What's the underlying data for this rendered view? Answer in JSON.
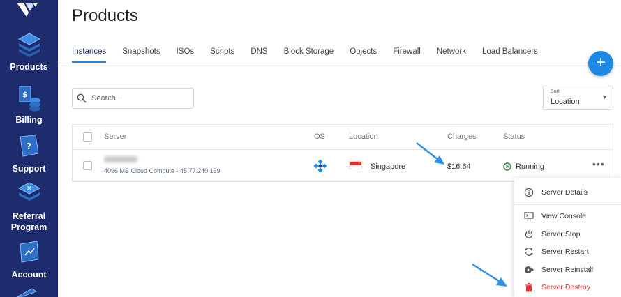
{
  "sidebar": {
    "items": [
      {
        "label": "Products"
      },
      {
        "label": "Billing"
      },
      {
        "label": "Support"
      },
      {
        "label": "Referral Program"
      },
      {
        "label": "Account"
      }
    ]
  },
  "page": {
    "title": "Products"
  },
  "tabs": [
    {
      "label": "Instances"
    },
    {
      "label": "Snapshots"
    },
    {
      "label": "ISOs"
    },
    {
      "label": "Scripts"
    },
    {
      "label": "DNS"
    },
    {
      "label": "Block Storage"
    },
    {
      "label": "Objects"
    },
    {
      "label": "Firewall"
    },
    {
      "label": "Network"
    },
    {
      "label": "Load Balancers"
    }
  ],
  "fab": {
    "label": "+"
  },
  "search": {
    "placeholder": "Search..."
  },
  "sort": {
    "label": "Sort",
    "value": "Location"
  },
  "table": {
    "headers": {
      "server": "Server",
      "os": "OS",
      "location": "Location",
      "charges": "Charges",
      "status": "Status"
    },
    "rows": [
      {
        "server_subtitle": "4096 MB Cloud Compute - 45.77.240.139",
        "location": "Singapore",
        "charges": "$16.64",
        "status": "Running",
        "more": "•••"
      }
    ]
  },
  "menu": {
    "items": [
      {
        "label": "Server Details",
        "icon": "info-icon"
      },
      {
        "label": "View Console",
        "icon": "monitor-icon"
      },
      {
        "label": "Server Stop",
        "icon": "power-icon"
      },
      {
        "label": "Server Restart",
        "icon": "restart-icon"
      },
      {
        "label": "Server Reinstall",
        "icon": "reinstall-icon"
      },
      {
        "label": "Server Destroy",
        "icon": "trash-icon"
      }
    ]
  },
  "colors": {
    "sidebar": "#1e2c6e",
    "accent": "#1e88e5",
    "danger": "#e53935",
    "running": "#2e7d32"
  }
}
